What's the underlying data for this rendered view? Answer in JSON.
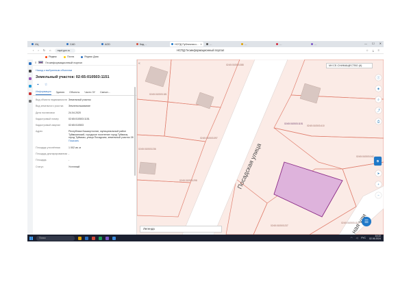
{
  "browser": {
    "tabs": [
      {
        "label": "ИЦ",
        "color": "#2a6fc0"
      },
      {
        "label": "CAD",
        "color": "#2a6fc0"
      },
      {
        "label": "AOD",
        "color": "#2a6fc0"
      },
      {
        "label": "Кад…",
        "color": "#d14b3a"
      },
      {
        "label": "НСПД Публичная к…",
        "color": "#1f78c8",
        "active": true
      },
      {
        "label": "…",
        "color": "#555"
      },
      {
        "label": "…",
        "color": "#e0a000"
      },
      {
        "label": "…",
        "color": "#d0263b"
      },
      {
        "label": "…",
        "color": "#7a55c8"
      }
    ],
    "url": "nspd.gov.ru",
    "page_title": "НСПД Геоинформационный портал",
    "bookmarks": [
      {
        "label": "Яндекс",
        "color": "#ff3d00"
      },
      {
        "label": "Почта",
        "color": "#ffcc00"
      },
      {
        "label": "Яндекс Диск",
        "color": "#2a6fc0"
      }
    ]
  },
  "panel": {
    "header": "Геоинформационный портал",
    "back_link": "Назад к выбранным объектам",
    "title": "Земельный участок: 02:65:010503:1151",
    "tabs": [
      "Информация",
      "Здания",
      "Объекты",
      "Части ЗУ",
      "Смежн…"
    ],
    "props": [
      {
        "label": "Вид объекта недвижимости",
        "value": "Земельный участок"
      },
      {
        "label": "Вид земельного участка",
        "value": "Землепользование"
      },
      {
        "label": "Дата постановки",
        "value": "24.04.2020"
      },
      {
        "label": "Кадастровый номер",
        "value": "02:65:010503:1151"
      },
      {
        "label": "Кадастровый квартал",
        "value": "02:65:010503"
      },
      {
        "label": "Адрес",
        "value": "Республика Башкортостан, муниципальный район Туймазинский, городское поселение город Туймазы, город Туймазы, улица Посадская, земельный участок 28"
      },
      {
        "label": "",
        "value": "Показать"
      },
      {
        "label": "Площадь уточнённая",
        "value": "1 002 кв. м"
      },
      {
        "label": "Площадь декларированная",
        "value": "-"
      },
      {
        "label": "Площадь",
        "value": "-"
      },
      {
        "label": "Статус",
        "value": "Учтенный"
      }
    ]
  },
  "map": {
    "street_label": "Посадская улица",
    "street_label_2": "ная ули",
    "layer_select": "МУ.СЕ.СНИМАЩЕСТВО (6)",
    "search_placeholder": "Легенда",
    "parcels": [
      {
        "id": "02:65:010503:1151",
        "selected": true
      },
      {
        "id": "02:65:010503:181"
      },
      {
        "id": "02:65:010503:397"
      },
      {
        "id": "02:65:010503:388"
      },
      {
        "id": "02:65:010503:410"
      },
      {
        "id": "02:65:010503:236"
      },
      {
        "id": "02:65:010503:237"
      },
      {
        "id": "02:65:010503:1112"
      },
      {
        "id": "02:65:010503:342"
      },
      {
        "id": "02:65:010503:298"
      }
    ],
    "colors": {
      "background": "#fbebe6",
      "road": "#ffffff",
      "parcel_border": "#e07f6e",
      "selected_fill": "#deb3dc",
      "selected_border": "#8a2a86",
      "building": "#d9c7c2"
    }
  },
  "taskbar": {
    "search": "Поиск",
    "tray_lang": "РУС",
    "time": "14:22",
    "date": "02.06.2024"
  }
}
